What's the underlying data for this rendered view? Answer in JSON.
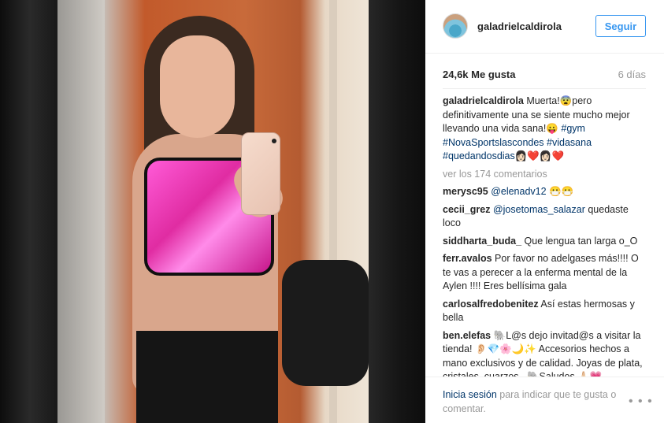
{
  "post": {
    "username": "galadrielcaldirola",
    "follow_label": "Seguir",
    "likes": "24,6k Me gusta",
    "time_ago": "6 días",
    "caption_user": "galadrielcaldirola",
    "caption_text_1": "Muerta!😨pero definitivamente una se siente mucho mejor llevando una vida sana!😛",
    "caption_tags": [
      "#gym",
      "#NovaSportslascondes",
      "#vidasana",
      "#quedandosdias"
    ],
    "caption_emojis": "👩🏻❤️👩🏻❤️",
    "view_comments": "ver los 174 comentarios"
  },
  "comments": [
    {
      "user": "merysc95",
      "mention": "@elenadv12",
      "text": "😷😷"
    },
    {
      "user": "cecii_grez",
      "mention": "@josetomas_salazar",
      "text": "quedaste loco"
    },
    {
      "user": "siddharta_buda_",
      "mention": "",
      "text": "Que lengua tan larga o_O"
    },
    {
      "user": "ferr.avalos",
      "mention": "",
      "text": "Por favor no adelgases más!!!! O te vas a perecer a la enferma mental de la Aylen !!!! Eres bellísima gala"
    },
    {
      "user": "carlosalfredobenitez",
      "mention": "",
      "text": "Así estas hermosas y bella"
    },
    {
      "user": "ben.elefas",
      "mention": "",
      "text": "🐘L@s dejo invitad@s a visitar la tienda! 👂🏻💎🌸🌙✨ Accesorios hechos a mano exclusivos y de calidad. Joyas de plata, cristales, cuarzos...🐘Saludos 🙏🏻💗"
    }
  ],
  "footer": {
    "login_link": "Inicia sesión",
    "login_rest": "para indicar que te gusta o comentar.",
    "more_icon": "ellipsis-icon"
  }
}
